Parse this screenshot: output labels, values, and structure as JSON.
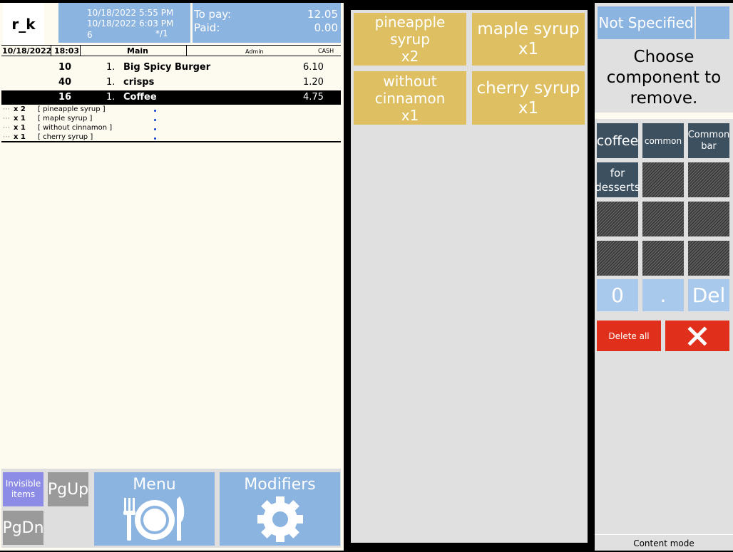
{
  "header": {
    "logo": "r_k",
    "date_open": "10/18/2022 5:55 PM",
    "date_now": "10/18/2022 6:03 PM",
    "table_no": "6",
    "guests": "*/1",
    "to_pay_label": "To pay:",
    "to_pay_value": "12.05",
    "paid_label": "Paid:",
    "paid_value": "0.00"
  },
  "order_header": {
    "date": "10/18/2022",
    "time": "18:03",
    "section": "Main",
    "user": "Admin",
    "payment": "CASH"
  },
  "order_items": [
    {
      "code": "10",
      "qty": "1.",
      "name": "Big Spicy Burger",
      "price": "6.10"
    },
    {
      "code": "40",
      "qty": "1.",
      "name": "crisps",
      "price": "1.20"
    },
    {
      "code": "16",
      "qty": "1.",
      "name": "Coffee",
      "price": "4.75"
    }
  ],
  "modifiers": [
    {
      "qty": "x 2",
      "name": "[ pineapple syrup ]"
    },
    {
      "qty": "x 1",
      "name": "[ maple syrup ]"
    },
    {
      "qty": "x 1",
      "name": "[ without cinnamon ]"
    },
    {
      "qty": "x 1",
      "name": "[ cherry syrup ]"
    }
  ],
  "bottom_buttons": {
    "invisible": "Invisible items",
    "pgup": "PgUp",
    "pgdn": "PgDn",
    "menu": "Menu",
    "modifiers": "Modifiers"
  },
  "tiles": [
    {
      "name": "pineapple syrup",
      "count": "x2"
    },
    {
      "name": "maple syrup",
      "count": "x1"
    },
    {
      "name": "without cinnamon",
      "count": "x1"
    },
    {
      "name": "cherry syrup",
      "count": "x1"
    }
  ],
  "right": {
    "not_specified": "Not Specified",
    "prompt": "Choose component to remove.",
    "keys": [
      "coffee",
      "common",
      "Common bar",
      "for desserts"
    ],
    "zero": "0",
    "dot": ".",
    "del": "Del",
    "delete_all": "Delete all",
    "status": "Content mode"
  },
  "colors": {
    "accent_blue": "#8cb4e0",
    "tile_gold": "#dec063",
    "danger_red": "#e0301c",
    "key_dark": "#3d5060"
  }
}
